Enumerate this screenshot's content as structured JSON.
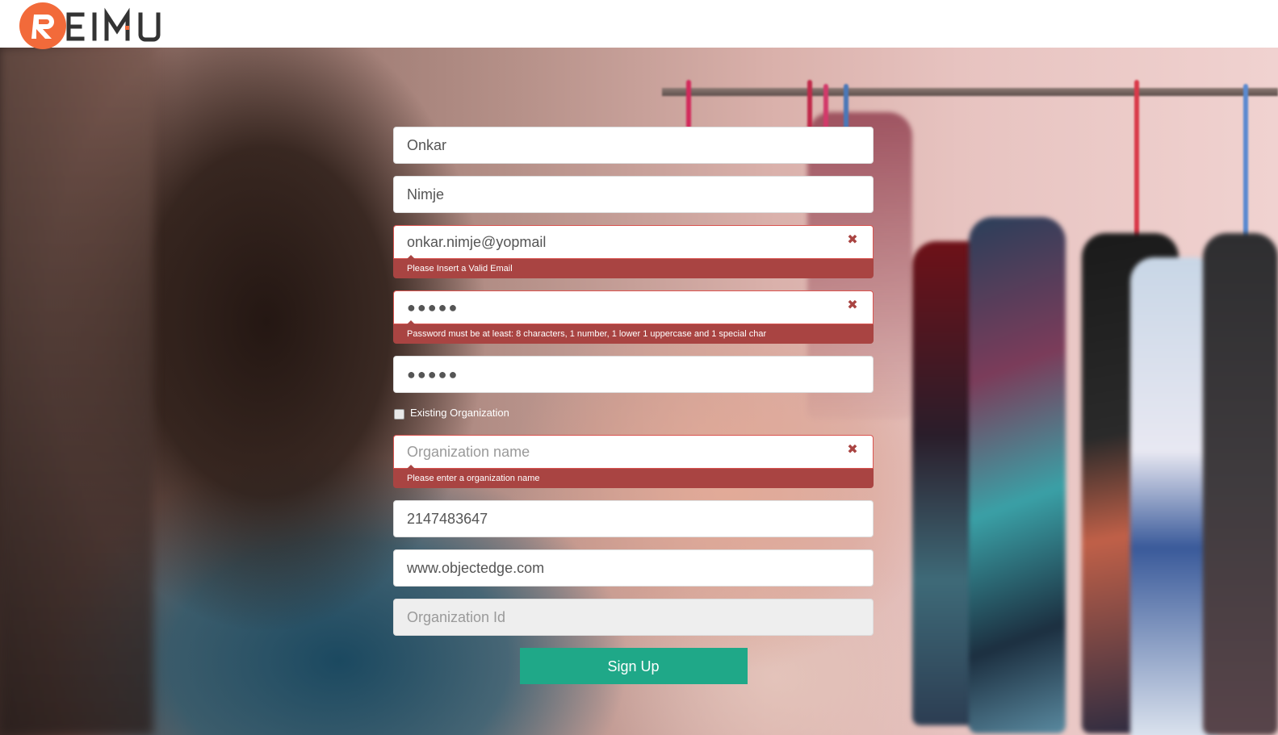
{
  "brand": {
    "logo_text": "REIMU",
    "accent_color": "#f26a3a"
  },
  "form": {
    "first_name": {
      "value": "Onkar"
    },
    "last_name": {
      "value": "Nimje"
    },
    "email": {
      "value": "onkar.nimje@yopmail",
      "error": "Please Insert a Valid Email"
    },
    "password": {
      "value": "●●●●●",
      "error": "Password must be at least: 8 characters, 1 number, 1 lower 1 uppercase and 1 special char"
    },
    "confirm_password": {
      "value": "●●●●●"
    },
    "existing_org": {
      "label": "Existing Organization",
      "checked": false
    },
    "org_name": {
      "placeholder": "Organization name",
      "value": "",
      "error": "Please enter a organization name"
    },
    "phone": {
      "value": "2147483647"
    },
    "website": {
      "value": "www.objectedge.com"
    },
    "org_id": {
      "placeholder": "Organization Id",
      "value": ""
    },
    "submit_label": "Sign Up"
  },
  "colors": {
    "error": "#a94442",
    "primary_button": "#1fa888"
  }
}
